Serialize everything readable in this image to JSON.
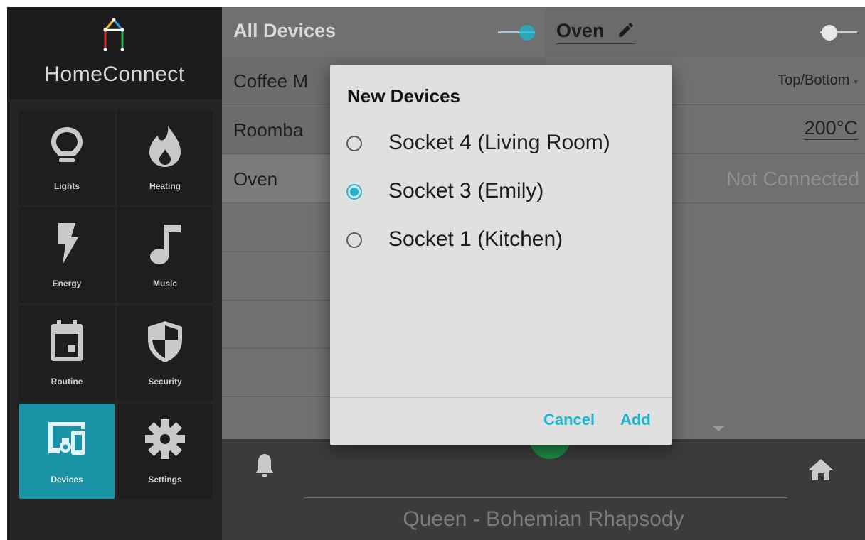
{
  "app": {
    "brand": "HomeConnect"
  },
  "colors": {
    "accent": "#1ab7d4",
    "active_tile": "#1a93a6",
    "fab": "#1e8b48"
  },
  "sidebar": {
    "tiles": [
      {
        "label": "Lights",
        "icon": "lightbulb-icon"
      },
      {
        "label": "Heating",
        "icon": "flame-icon"
      },
      {
        "label": "Energy",
        "icon": "lightning-icon"
      },
      {
        "label": "Music",
        "icon": "music-note-icon"
      },
      {
        "label": "Routine",
        "icon": "calendar-icon"
      },
      {
        "label": "Security",
        "icon": "shield-icon"
      },
      {
        "label": "Devices",
        "icon": "devices-icon",
        "active": true
      },
      {
        "label": "Settings",
        "icon": "gear-icon"
      }
    ]
  },
  "devices_panel": {
    "title": "All Devices",
    "toggle_on": true,
    "rows": [
      "Coffee M",
      "Roomba",
      "Oven"
    ]
  },
  "detail_panel": {
    "title": "Oven",
    "toggle_on": false,
    "rows": [
      "Top/Bottom",
      "200°C",
      "Not Connected"
    ]
  },
  "now_playing": "Queen - Bohemian Rhapsody",
  "dialog": {
    "title": "New Devices",
    "options": [
      {
        "label": "Socket 4 (Living Room)",
        "selected": false
      },
      {
        "label": "Socket 3 (Emily)",
        "selected": true
      },
      {
        "label": "Socket 1 (Kitchen)",
        "selected": false
      }
    ],
    "cancel_label": "Cancel",
    "add_label": "Add"
  }
}
